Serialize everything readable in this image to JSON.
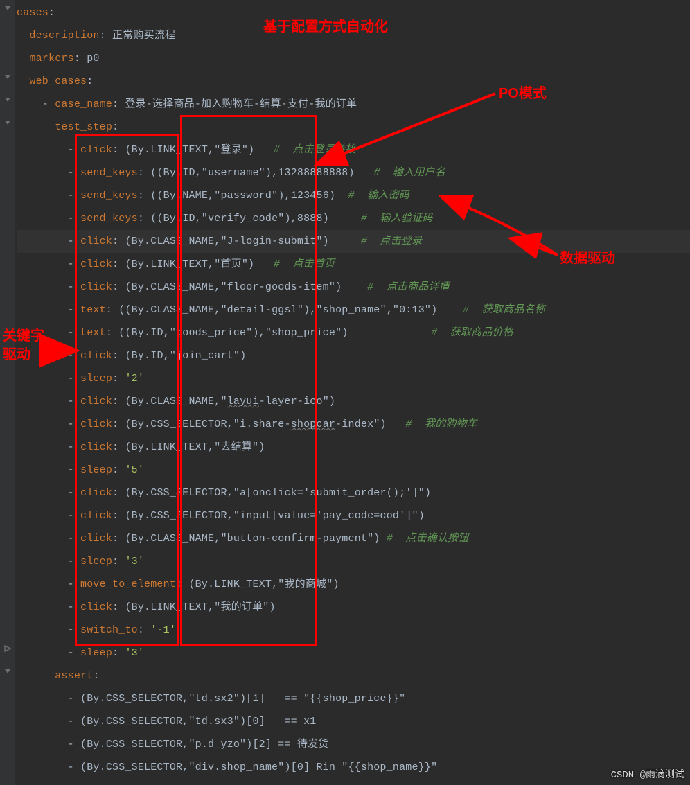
{
  "annotations": {
    "title_top": "基于配置方式自动化",
    "po_mode": "PO模式",
    "data_driven": "数据驱动",
    "keyword_driven_1": "关键字",
    "keyword_driven_2": "驱动"
  },
  "watermark": "CSDN @雨滴测试",
  "yaml": {
    "cases_key": "cases",
    "description_key": "description",
    "description_val": "正常购买流程",
    "markers_key": "markers",
    "markers_val": "p0",
    "web_cases_key": "web_cases",
    "case_name_key": "case_name",
    "case_name_val": "登录-选择商品-加入购物车-结算-支付-我的订单",
    "test_step_key": "test_step",
    "assert_key": "assert"
  },
  "steps": [
    {
      "action": "click",
      "args": "(By.LINK_TEXT,\"登录\")",
      "comment": "#  点击登录链接"
    },
    {
      "action": "send_keys",
      "args": "((By.ID,\"username\"),13288888888)",
      "comment": "#  输入用户名"
    },
    {
      "action": "send_keys",
      "args": "((By.NAME,\"password\"),123456)",
      "comment": "#  输入密码"
    },
    {
      "action": "send_keys",
      "args": "((By.ID,\"verify_code\"),8888)",
      "comment": "#  输入验证码"
    },
    {
      "action": "click",
      "args": "(By.CLASS_NAME,\"J-login-submit\")",
      "comment": "#  点击登录"
    },
    {
      "action": "click",
      "args": "(By.LINK_TEXT,\"首页\")",
      "comment": "#  点击首页"
    },
    {
      "action": "click",
      "args": "(By.CLASS_NAME,\"floor-goods-item\")",
      "comment": "#  点击商品详情"
    },
    {
      "action": "text",
      "args": "((By.CLASS_NAME,\"detail-ggsl\"),\"shop_name\",\"0:13\")",
      "comment": "#  获取商品名称"
    },
    {
      "action": "text",
      "args": "((By.ID,\"goods_price\"),\"shop_price\")",
      "comment": "#  获取商品价格"
    },
    {
      "action": "click",
      "args": "(By.ID,\"join_cart\")",
      "comment": ""
    },
    {
      "action": "sleep",
      "args": "'2'",
      "comment": ""
    },
    {
      "action": "click",
      "args": "(By.CLASS_NAME,\"layui-layer-ico\")",
      "comment": ""
    },
    {
      "action": "click",
      "args": "(By.CSS_SELECTOR,\"i.share-shopcar-index\")",
      "comment": "#  我的购物车"
    },
    {
      "action": "click",
      "args": "(By.LINK_TEXT,\"去结算\")",
      "comment": ""
    },
    {
      "action": "sleep",
      "args": "'5'",
      "comment": ""
    },
    {
      "action": "click",
      "args": "(By.CSS_SELECTOR,\"a[onclick='submit_order();']\")",
      "comment": ""
    },
    {
      "action": "click",
      "args": "(By.CSS_SELECTOR,\"input[value='pay_code=cod']\")",
      "comment": ""
    },
    {
      "action": "click",
      "args": "(By.CLASS_NAME,\"button-confirm-payment\")",
      "comment": "#  点击确认按钮"
    },
    {
      "action": "sleep",
      "args": "'3'",
      "comment": ""
    },
    {
      "action": "move_to_element",
      "args": "(By.LINK_TEXT,\"我的商城\")",
      "comment": ""
    },
    {
      "action": "click",
      "args": "(By.LINK_TEXT,\"我的订单\")",
      "comment": ""
    },
    {
      "action": "switch_to",
      "args": "'-1'",
      "comment": ""
    },
    {
      "action": "sleep",
      "args": "'3'",
      "comment": ""
    }
  ],
  "asserts": [
    "(By.CSS_SELECTOR,\"td.sx2\")[1]   == \"{{shop_price}}\"",
    "(By.CSS_SELECTOR,\"td.sx3\")[0]   == x1",
    "(By.CSS_SELECTOR,\"p.d_yzo\")[2] == 待发货",
    "(By.CSS_SELECTOR,\"div.shop_name\")[0] Rin \"{{shop_name}}\""
  ]
}
